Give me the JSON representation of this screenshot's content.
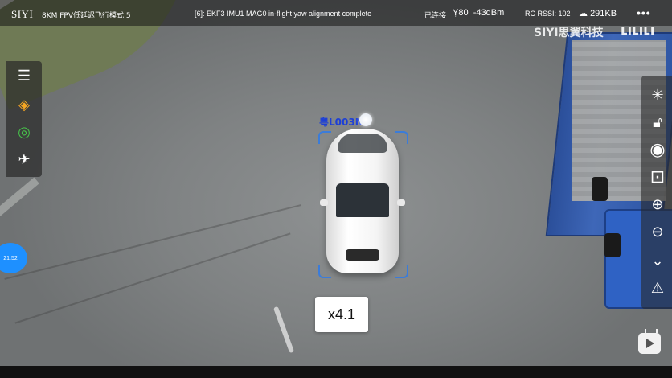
{
  "topbar": {
    "brand": "SIYI",
    "mode": "8KM FPV低延迟飞行模式 5",
    "message": "[6]: EKF3 IMU1 MAG0 in-flight yaw alignment complete",
    "connection": "已连接",
    "signal": "80",
    "dbm": "-43dBm",
    "rssi": "RC RSSI: 102",
    "rate": "291KB",
    "more": "•••"
  },
  "watermark": {
    "siyi": "SIYI思翼科技",
    "bilibili": "bilibili"
  },
  "target": {
    "plate": "粤L003N"
  },
  "clock": "21:52",
  "zoom": {
    "label": "x4.1",
    "level": 4.1
  },
  "icons": {
    "left": [
      "menu-icon",
      "waypoint-icon",
      "target-follow-icon",
      "takeoff-land-icon"
    ],
    "right": [
      "laser-icon",
      "lock-icon",
      "photo-icon",
      "record-icon",
      "zoom-in-icon",
      "zoom-out-icon",
      "gimbal-down-icon",
      "warning-icon"
    ]
  },
  "colors": {
    "accent": "#1e90ff",
    "bracket": "#3b7cd9",
    "waypoint": "#f5a623",
    "follow": "#47c44a"
  }
}
